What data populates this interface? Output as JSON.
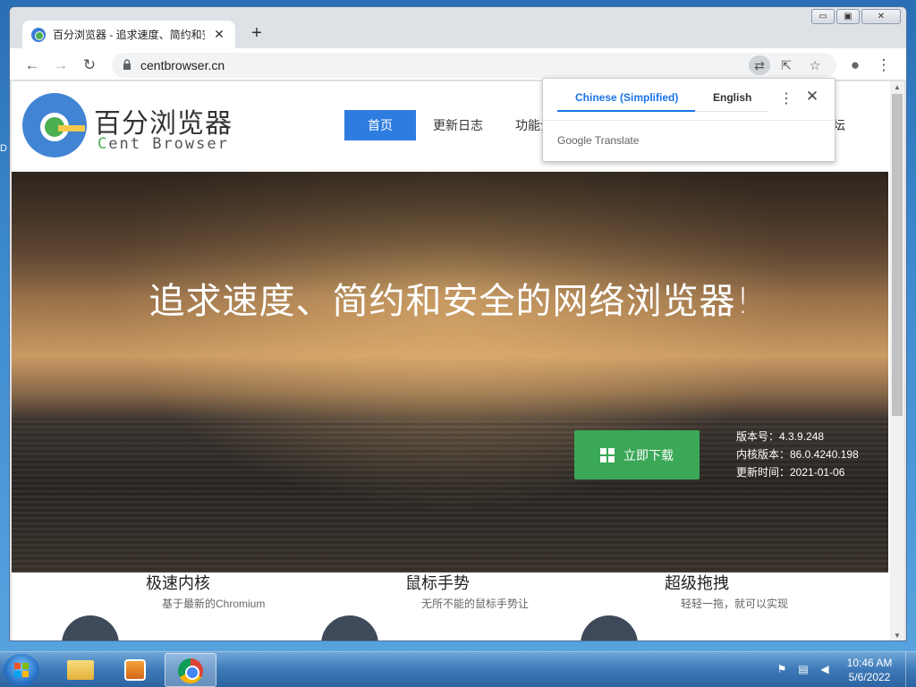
{
  "browser": {
    "tab_title": "百分浏览器 - 追求速度、简约和安",
    "tab_close": "✕",
    "new_tab": "+",
    "url": "centbrowser.cn",
    "window_controls": {
      "minimize": "▭",
      "maximize": "▣",
      "close": "✕"
    },
    "toolbar_icons": {
      "back": "←",
      "forward": "→",
      "reload": "↻",
      "translate": "⇄",
      "share": "⇱",
      "bookmark": "☆",
      "profile": "●",
      "menu": "⋮"
    }
  },
  "translate_popup": {
    "source_lang": "Chinese (Simplified)",
    "target_lang": "English",
    "menu": "⋮",
    "close": "✕",
    "brand": "Google Translate"
  },
  "site": {
    "logo_cn": "百分浏览器",
    "logo_en_c": "C",
    "logo_en_rest": "ent Browser",
    "nav": [
      {
        "label": "首页",
        "active": true
      },
      {
        "label": "更新日志"
      },
      {
        "label": "功能介"
      }
    ],
    "nav_forum": "坛",
    "hero_title": "追求速度、简约和安全的网络浏览器!",
    "download_label": "立即下载",
    "version": "版本号：4.3.9.248",
    "core_version": "内核版本：86.0.4240.198",
    "update_time": "更新时间：2021-01-06",
    "features": [
      {
        "title": "极速内核",
        "desc": "基于最新的Chromium"
      },
      {
        "title": "鼠标手势",
        "desc": "无所不能的鼠标手势让"
      },
      {
        "title": "超级拖拽",
        "desc": "轻轻一拖，就可以实现"
      }
    ]
  },
  "taskbar": {
    "time": "10:46 AM",
    "date": "5/6/2022"
  },
  "colors": {
    "accent_blue": "#2e7ce0",
    "download_green": "#3aa857",
    "translate_blue": "#1a73e8"
  }
}
